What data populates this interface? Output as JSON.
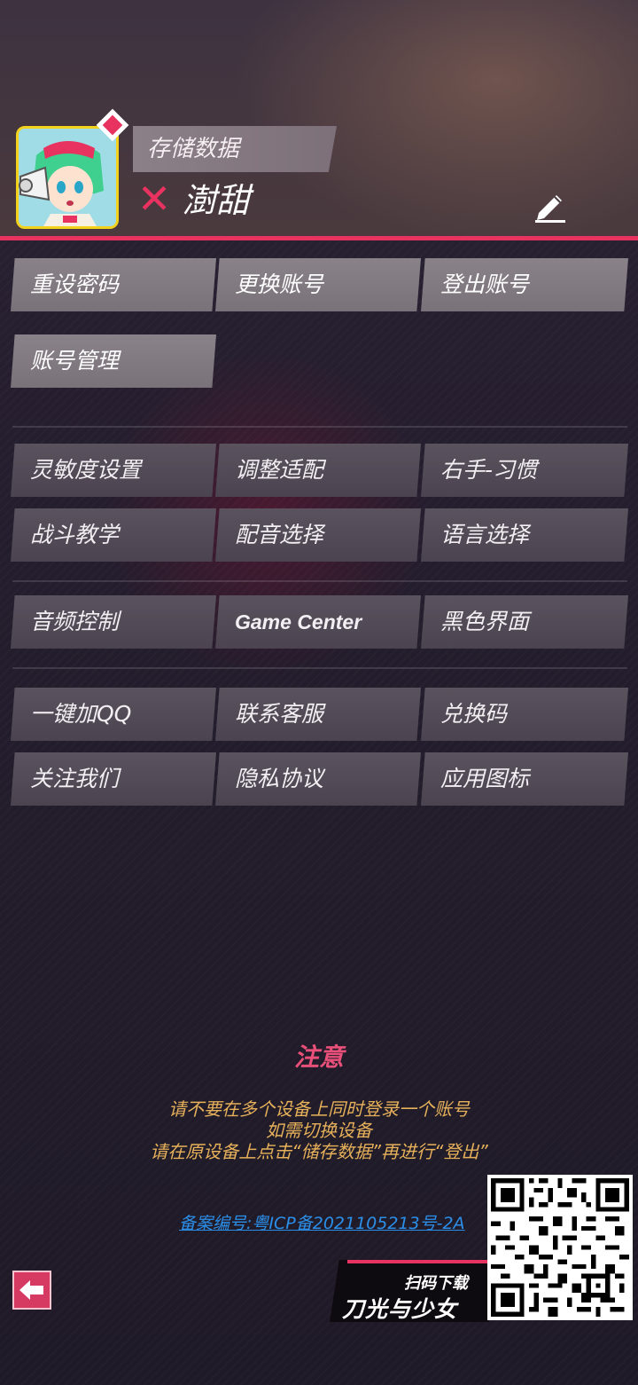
{
  "profile": {
    "save_data_label": "存储数据",
    "nickname": "澍甜"
  },
  "account_buttons": [
    {
      "label": "重设密码"
    },
    {
      "label": "更换账号"
    },
    {
      "label": "登出账号"
    },
    {
      "label": "账号管理"
    }
  ],
  "settings_buttons": [
    {
      "label": "灵敏度设置"
    },
    {
      "label": "调整适配"
    },
    {
      "label": "右手-习惯"
    },
    {
      "label": "战斗教学"
    },
    {
      "label": "配音选择"
    },
    {
      "label": "语言选择"
    }
  ],
  "system_buttons": [
    {
      "label": "音频控制"
    },
    {
      "label": "Game Center"
    },
    {
      "label": "黑色界面"
    }
  ],
  "service_buttons": [
    {
      "label": "一键加QQ"
    },
    {
      "label": "联系客服"
    },
    {
      "label": "兑换码"
    },
    {
      "label": "关注我们"
    },
    {
      "label": "隐私协议"
    },
    {
      "label": "应用图标"
    }
  ],
  "notice": {
    "title": "注意",
    "lines": [
      "请不要在多个设备上同时登录一个账号",
      "如需切换设备",
      "请在原设备上点击“储存数据”再进行“登出”"
    ]
  },
  "icp_text": "备案编号:粤ICP备2021105213号-2A",
  "download": {
    "scan_text": "扫码下载",
    "brand": "刀光与少女"
  },
  "colors": {
    "accent": "#e8325f",
    "notice_title": "#e8507a",
    "notice_text": "#e6b15a",
    "link": "#2b8ee8"
  }
}
